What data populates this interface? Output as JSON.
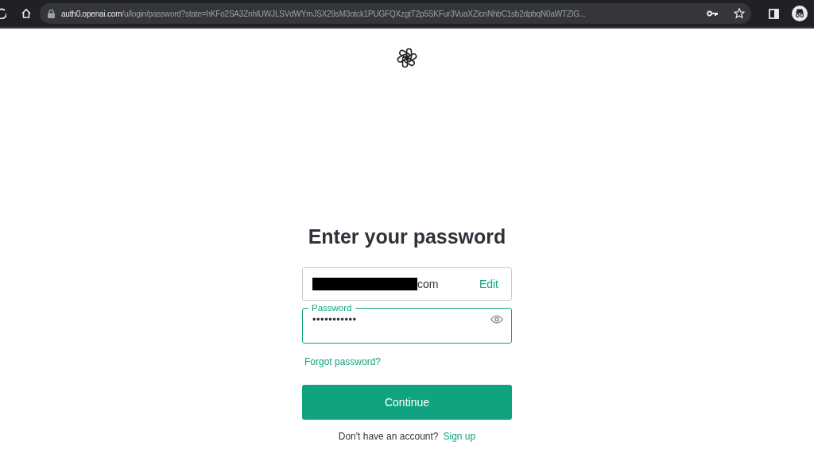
{
  "browser": {
    "url_host": "auth0.openai.com",
    "url_path": "/u/login/password?state=hKFo2SA3ZnhlUWJLSVdWYmJSX29sM3otck1PUGFQXzgtT2p5SKFur3VuaXZlcnNhbC1sb2dpbqN0aWTZIG..."
  },
  "heading": "Enter your password",
  "email": {
    "visible_text": "com",
    "redacted": true,
    "edit_label": "Edit"
  },
  "password": {
    "label": "Password",
    "value": "•••••••••••",
    "focused": true
  },
  "forgot_link": "Forgot password?",
  "continue_button": "Continue",
  "signup": {
    "prompt": "Don't have an account?",
    "link": "Sign up"
  }
}
